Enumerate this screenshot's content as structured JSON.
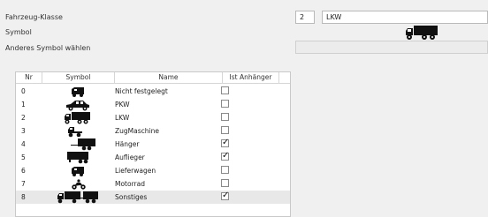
{
  "form": {
    "class_label": "Fahrzeug-Klasse",
    "symbol_label": "Symbol",
    "choose_label": "Anderes Symbol wählen",
    "class_number": "2",
    "class_name": "LKW"
  },
  "table": {
    "headers": [
      "Nr",
      "Symbol",
      "Name",
      "Ist Anhänger"
    ],
    "rows": [
      {
        "nr": "0",
        "icon": "van-icon",
        "name": "Nicht festgelegt",
        "trailer": false
      },
      {
        "nr": "1",
        "icon": "car-icon",
        "name": "PKW",
        "trailer": false
      },
      {
        "nr": "2",
        "icon": "truck-icon",
        "name": "LKW",
        "trailer": false
      },
      {
        "nr": "3",
        "icon": "tractor-unit-icon",
        "name": "ZugMaschine",
        "trailer": false
      },
      {
        "nr": "4",
        "icon": "trailer-icon",
        "name": "Hänger",
        "trailer": true
      },
      {
        "nr": "5",
        "icon": "semitrailer-icon",
        "name": "Auflieger",
        "trailer": true
      },
      {
        "nr": "6",
        "icon": "van-icon",
        "name": "Lieferwagen",
        "trailer": false
      },
      {
        "nr": "7",
        "icon": "motorcycle-icon",
        "name": "Motorrad",
        "trailer": false
      },
      {
        "nr": "8",
        "icon": "truck-with-trailer-icon",
        "name": "Sonstiges",
        "trailer": true
      }
    ],
    "selected_row": 8
  },
  "colors": {
    "selected_row_bg": "#e8e8e8",
    "icon_color": "#111111"
  }
}
